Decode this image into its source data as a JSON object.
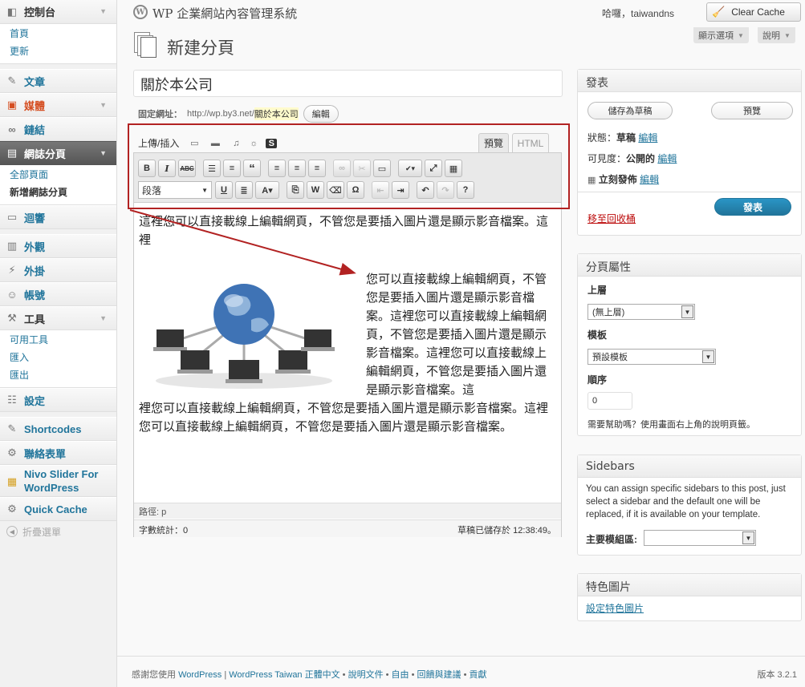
{
  "header": {
    "site_title": "WP 企業網站內容管理系統",
    "howdy": "哈囉，taiwandns",
    "clear_cache": "Clear Cache",
    "screen_options": "顯示選項",
    "help": "說明"
  },
  "sidebar": {
    "dashboard": "控制台",
    "dashboard_sub": [
      "首頁",
      "更新"
    ],
    "posts": "文章",
    "media": "媒體",
    "links": "鏈結",
    "pages": "網誌分頁",
    "pages_sub": [
      "全部頁面",
      "新增網誌分頁"
    ],
    "comments": "迴響",
    "appearance": "外觀",
    "plugins": "外掛",
    "users": "帳號",
    "tools": "工具",
    "tools_sub": [
      "可用工具",
      "匯入",
      "匯出"
    ],
    "settings": "設定",
    "shortcodes": "Shortcodes",
    "contact_form": "聯絡表單",
    "nivo_slider": "Nivo Slider For WordPress",
    "quick_cache": "Quick Cache",
    "collapse": "折疊選單"
  },
  "page": {
    "title": "新建分頁",
    "post_title": "關於本公司",
    "permalink_label": "固定網址：",
    "permalink_base": "http://wp.by3.net/",
    "permalink_slug": "關於本公司",
    "permalink_edit": "編輯"
  },
  "editor": {
    "upload_insert": "上傳/插入",
    "tab_visual": "預覽",
    "tab_html": "HTML",
    "format_select": "段落",
    "paragraph1": "這裡您可以直接載線上編輯網頁，不管您是要插入圖片還是顯示影音檔案。這裡",
    "float_text": "您可以直接載線上編輯網頁，不管您是要插入圖片還是顯示影音檔案。這裡您可以直接載線上編輯網頁，不管您是要插入圖片還是顯示影音檔案。這裡您可以直接載線上編輯網頁，不管您是要插入圖片還是顯示影音檔案。這",
    "after_text": "裡您可以直接載線上編輯網頁，不管您是要插入圖片還是顯示影音檔案。這裡您可以直接載線上編輯網頁，不管您是要插入圖片還是顯示影音檔案。",
    "path": "路徑: p",
    "word_count": "字數統計：0",
    "draft_saved": "草稿已儲存於 12:38:49。"
  },
  "publish": {
    "title": "發表",
    "save_draft": "儲存為草稿",
    "preview": "預覽",
    "status_label": "狀態：",
    "status_value": "草稿",
    "visibility_label": "可見度：",
    "visibility_value": "公開的",
    "publish_label": "立刻發佈",
    "edit": "編輯",
    "trash": "移至回收桶",
    "publish_btn": "發表"
  },
  "page_attributes": {
    "title": "分頁屬性",
    "parent_label": "上層",
    "parent_value": "(無上層)",
    "template_label": "模板",
    "template_value": "預設模板",
    "order_label": "順序",
    "order_value": "0",
    "help_text": "需要幫助嗎？使用畫面右上角的說明頁籤。"
  },
  "sidebars_box": {
    "title": "Sidebars",
    "description": "You can assign specific sidebars to this post, just select a sidebar and the default one will be replaced, if it is available on your template.",
    "main_label": "主要模組區:"
  },
  "featured_image": {
    "title": "特色圖片",
    "link": "設定特色圖片"
  },
  "footer": {
    "thanks": "感謝您使用 ",
    "wordpress": "WordPress",
    "sep": " | ",
    "wp_taiwan": "WordPress Taiwan 正體中文",
    "docs": "說明文件",
    "freedoms": "自由",
    "feedback": "回饋與建議",
    "credits": "貢獻",
    "dot": " • ",
    "version": "版本 3.2.1"
  },
  "colors": {
    "link": "#21759b",
    "accent_red": "#b22222",
    "publish_blue": "#21759b"
  }
}
